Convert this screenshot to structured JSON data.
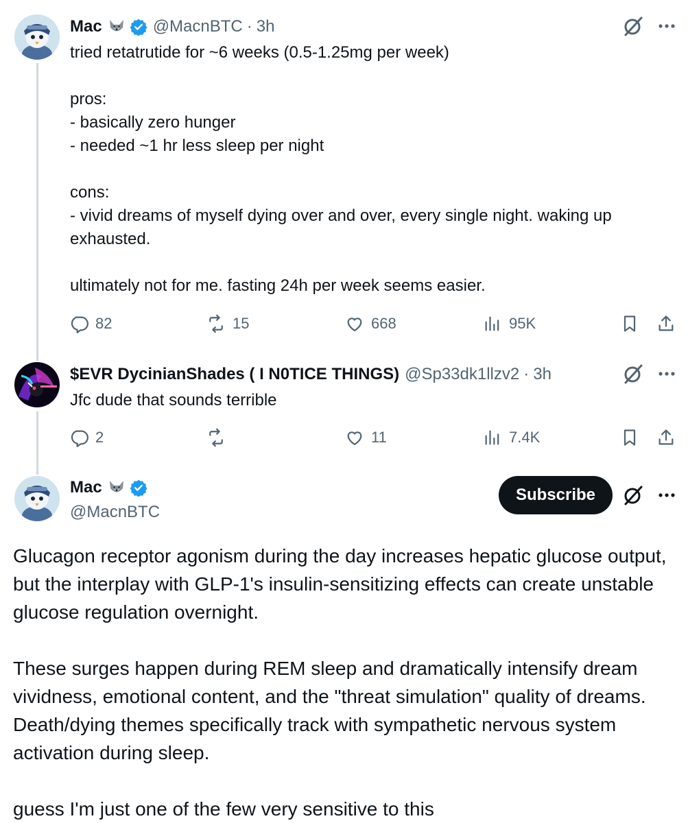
{
  "posts": [
    {
      "display_name": "Mac",
      "handle": "@MacnBTC",
      "separator": "·",
      "time": "3h",
      "text": "tried retatrutide for ~6 weeks (0.5-1.25mg per week)\n\npros:\n- basically zero hunger\n- needed ~1 hr less sleep per night\n\ncons:\n- vivid dreams of myself dying over and over, every single night. waking up exhausted.\n\nultimately not for me. fasting 24h per week seems easier.",
      "stats": {
        "replies": "82",
        "reposts": "15",
        "likes": "668",
        "views": "95K"
      }
    },
    {
      "display_name": "$EVR DycinianShades ( I N0TICE THINGS)",
      "handle": "@Sp33dk1llzv2",
      "separator": "·",
      "time": "3h",
      "text": "Jfc dude that sounds terrible",
      "stats": {
        "replies": "2",
        "reposts": "",
        "likes": "11",
        "views": "7.4K"
      }
    }
  ],
  "main_post": {
    "display_name": "Mac",
    "handle": "@MacnBTC",
    "subscribe_label": "Subscribe",
    "text": "Glucagon receptor agonism during the day increases hepatic glucose output, but the interplay with GLP-1's insulin-sensitizing effects can create unstable glucose regulation overnight.\n\nThese surges happen during REM sleep and dramatically intensify dream vividness, emotional content, and the \"threat simulation\" quality of dreams. Death/dying themes specifically track with sympathetic nervous system activation during sleep.\n\nguess I'm just one of the few very sensitive to this"
  },
  "colors": {
    "text": "#0f1419",
    "secondary": "#536471",
    "verified_blue": "#1d9bf0",
    "thread_line": "#cfd9de",
    "button_bg": "#0f1419"
  },
  "icons": [
    "wolf-emoji-icon",
    "verified-badge-icon",
    "grok-icon",
    "more-icon",
    "reply-icon",
    "repost-icon",
    "like-icon",
    "views-icon",
    "bookmark-icon",
    "share-icon"
  ]
}
